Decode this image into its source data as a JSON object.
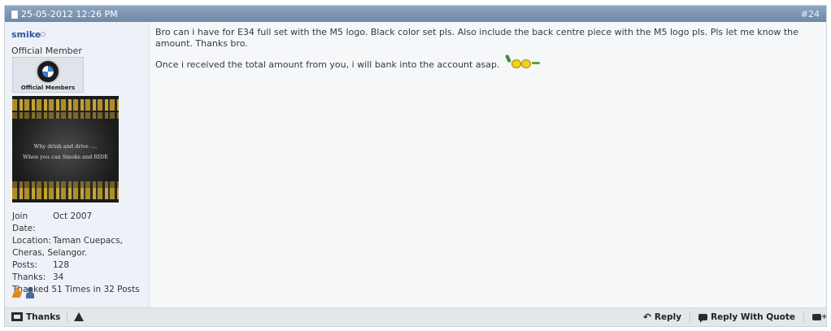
{
  "header": {
    "date": "25-05-2012 12:26 PM",
    "post_number": "#24"
  },
  "user": {
    "name": "smike",
    "title": "Official Member",
    "rank_image_label": "Official Members",
    "avatar_text": [
      "Why drink and drive ....",
      "When you can Smoke and RIDE"
    ],
    "join_date_label": "Join Date:",
    "join_date": "Oct 2007",
    "location_label": "Location:",
    "location_first": "Taman Cuepacs,",
    "location_rest": "Cheras, Selangor.",
    "posts_label": "Posts:",
    "posts": "128",
    "thanks_label": "Thanks:",
    "thanks": "34",
    "thanked": "Thanked 51 Times in 32 Posts"
  },
  "message": {
    "paragraph1": "Bro can i have for E34 full set with the M5 logo. Black color set pls. Also include the back centre piece with the M5 logo pls. Pls let me know the amount. Thanks bro.",
    "paragraph2": "Once i received the total amount from you, i will bank into the account asap."
  },
  "footer": {
    "thanks_label": "Thanks",
    "reply_label": "Reply",
    "reply_quote_label": "Reply With Quote"
  }
}
